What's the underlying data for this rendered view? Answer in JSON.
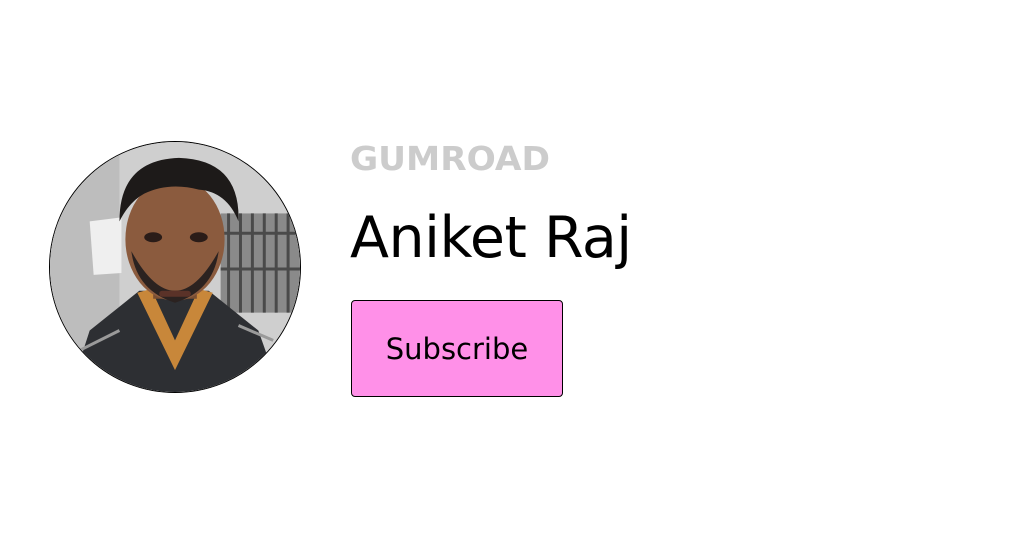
{
  "brand": {
    "name": "GUMROAD",
    "color": "#cccccc"
  },
  "profile": {
    "name": "Aniket Raj",
    "avatar_icon": "user-photo"
  },
  "subscribe_button": {
    "label": "Subscribe",
    "background": "#ff90e8"
  }
}
